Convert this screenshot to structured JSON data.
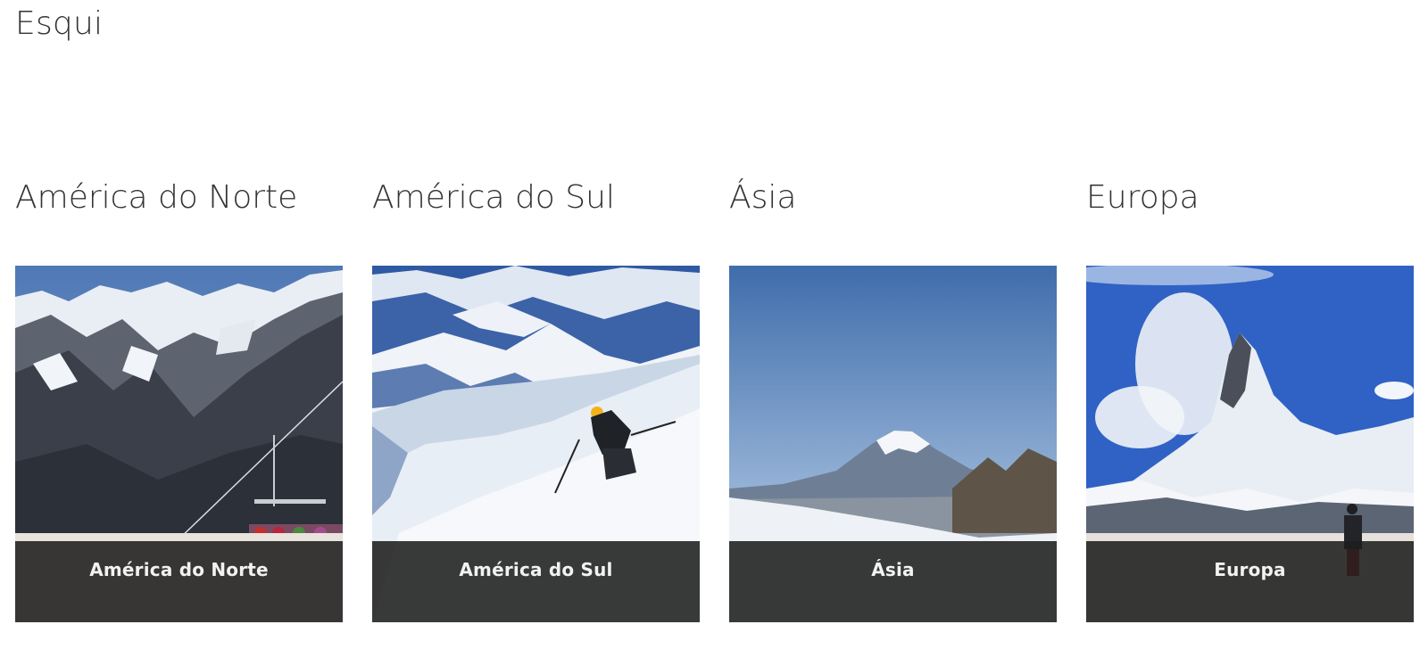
{
  "page": {
    "title": "Esqui"
  },
  "regions": [
    {
      "heading": "América do Norte",
      "caption": "América do Norte",
      "image": "ski-lift-mountains"
    },
    {
      "heading": "América do Sul",
      "caption": "América do Sul",
      "image": "skier-downhill"
    },
    {
      "heading": "Ásia",
      "caption": "Ásia",
      "image": "volcano-mountain"
    },
    {
      "heading": "Europa",
      "caption": "Europa",
      "image": "matterhorn-skier"
    }
  ]
}
